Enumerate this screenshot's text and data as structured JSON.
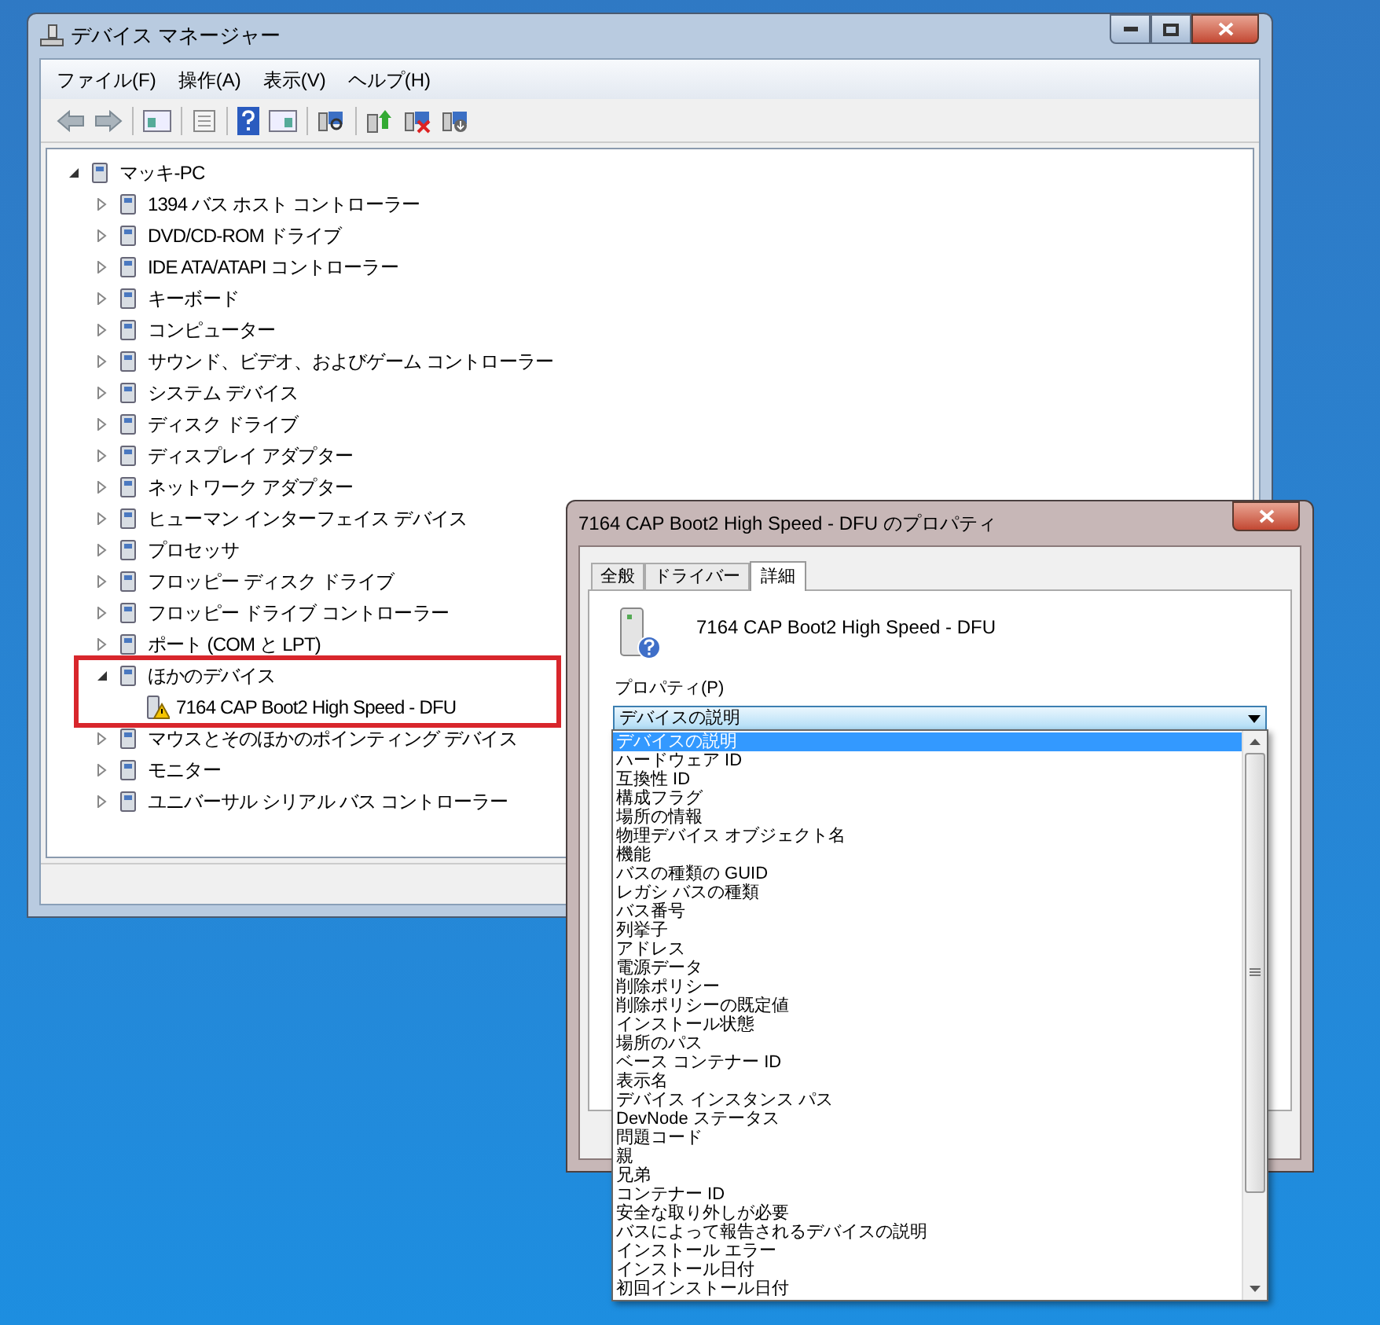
{
  "main_window": {
    "title": "デバイス マネージャー",
    "menu": [
      "ファイル(F)",
      "操作(A)",
      "表示(V)",
      "ヘルプ(H)"
    ],
    "tree": [
      {
        "label": "マッキ-PC",
        "expanded": true,
        "children": [
          {
            "label": "1394 バス ホスト コントローラー",
            "expanded": false
          },
          {
            "label": "DVD/CD-ROM ドライブ",
            "expanded": false
          },
          {
            "label": "IDE ATA/ATAPI コントローラー",
            "expanded": false
          },
          {
            "label": "キーボード",
            "expanded": false
          },
          {
            "label": "コンピューター",
            "expanded": false
          },
          {
            "label": "サウンド、ビデオ、およびゲーム コントローラー",
            "expanded": false
          },
          {
            "label": "システム デバイス",
            "expanded": false
          },
          {
            "label": "ディスク ドライブ",
            "expanded": false
          },
          {
            "label": "ディスプレイ アダプター",
            "expanded": false
          },
          {
            "label": "ネットワーク アダプター",
            "expanded": false
          },
          {
            "label": "ヒューマン インターフェイス デバイス",
            "expanded": false
          },
          {
            "label": "プロセッサ",
            "expanded": false
          },
          {
            "label": "フロッピー ディスク ドライブ",
            "expanded": false
          },
          {
            "label": "フロッピー ドライブ コントローラー",
            "expanded": false
          },
          {
            "label": "ポート (COM と LPT)",
            "expanded": false
          },
          {
            "label": "ほかのデバイス",
            "expanded": true,
            "highlighted": true,
            "children": [
              {
                "label": "7164 CAP Boot2 High Speed - DFU",
                "warning": true
              }
            ]
          },
          {
            "label": "マウスとそのほかのポインティング デバイス",
            "expanded": false
          },
          {
            "label": "モニター",
            "expanded": false
          },
          {
            "label": "ユニバーサル シリアル バス コントローラー",
            "expanded": false
          }
        ]
      }
    ]
  },
  "dialog": {
    "title": "7164 CAP Boot2 High Speed - DFU のプロパティ",
    "tabs": [
      {
        "label": "全般",
        "selected": false
      },
      {
        "label": "ドライバー",
        "selected": false
      },
      {
        "label": "詳細",
        "selected": true
      }
    ],
    "device_name": "7164 CAP Boot2 High Speed - DFU",
    "property_label": "プロパティ(P)",
    "dropdown": {
      "value": "デバイスの説明",
      "options": [
        {
          "label": "デバイスの説明",
          "selected": true
        },
        {
          "label": "ハードウェア ID",
          "selected": false
        },
        {
          "label": "互換性 ID",
          "selected": false
        },
        {
          "label": "構成フラグ",
          "selected": false
        },
        {
          "label": "場所の情報",
          "selected": false
        },
        {
          "label": "物理デバイス オブジェクト名",
          "selected": false
        },
        {
          "label": "機能",
          "selected": false
        },
        {
          "label": "バスの種類の GUID",
          "selected": false
        },
        {
          "label": "レガシ バスの種類",
          "selected": false
        },
        {
          "label": "バス番号",
          "selected": false
        },
        {
          "label": "列挙子",
          "selected": false
        },
        {
          "label": "アドレス",
          "selected": false
        },
        {
          "label": "電源データ",
          "selected": false
        },
        {
          "label": "削除ポリシー",
          "selected": false
        },
        {
          "label": "削除ポリシーの既定値",
          "selected": false
        },
        {
          "label": "インストール状態",
          "selected": false
        },
        {
          "label": "場所のパス",
          "selected": false
        },
        {
          "label": "ベース コンテナー ID",
          "selected": false
        },
        {
          "label": "表示名",
          "selected": false
        },
        {
          "label": "デバイス インスタンス パス",
          "selected": false
        },
        {
          "label": "DevNode ステータス",
          "selected": false
        },
        {
          "label": "問題コード",
          "selected": false
        },
        {
          "label": "親",
          "selected": false
        },
        {
          "label": "兄弟",
          "selected": false
        },
        {
          "label": "コンテナー ID",
          "selected": false
        },
        {
          "label": "安全な取り外しが必要",
          "selected": false
        },
        {
          "label": "バスによって報告されるデバイスの説明",
          "selected": false
        },
        {
          "label": "インストール エラー",
          "selected": false
        },
        {
          "label": "インストール日付",
          "selected": false
        },
        {
          "label": "初回インストール日付",
          "selected": false
        }
      ]
    }
  }
}
